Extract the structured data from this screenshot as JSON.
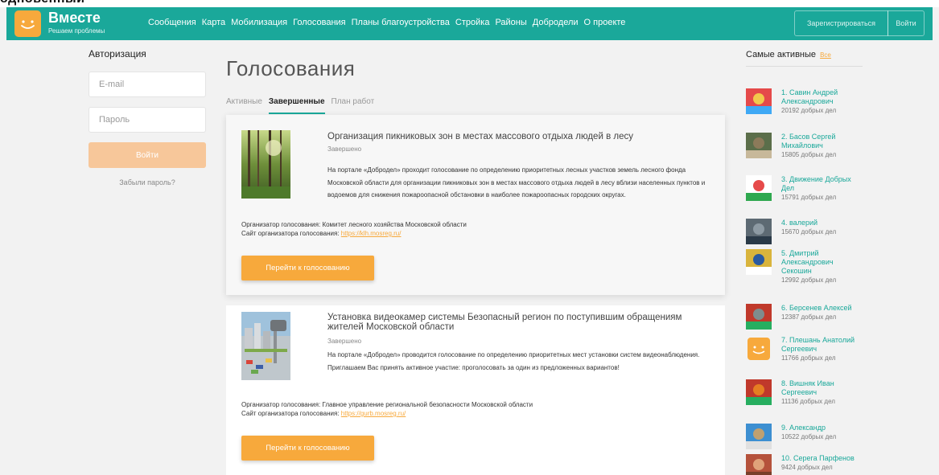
{
  "top_strip_text": "одновенный",
  "header": {
    "brand": "Вместе",
    "tagline": "Решаем проблемы",
    "nav": [
      "Сообщения",
      "Карта",
      "Мобилизация",
      "Голосования",
      "Планы благоустройства",
      "Стройка",
      "Районы",
      "Добродели",
      "О проекте"
    ],
    "register_label": "Зарегистрироваться",
    "login_label": "Войти"
  },
  "auth": {
    "title": "Авторизация",
    "email_placeholder": "E-mail",
    "password_placeholder": "Пароль",
    "login_button": "Войти",
    "forgot": "Забыли пароль?"
  },
  "main": {
    "title": "Голосования",
    "tabs": [
      "Активные",
      "Завершенные",
      "План работ"
    ],
    "active_tab": "Завершенные",
    "cards": [
      {
        "title": "Организация пикниковых зон в местах массового отдыха людей в лесу",
        "status": "Завершено",
        "description": "На портале «Добродел» проходит голосование по определению приоритетных лесных участков земель лесного фонда Московской области для организации пикниковых зон в местах массового отдыха людей в лесу вблизи населенных пунктов и водоемов для снижения пожароопасной обстановки в наиболее пожароопасных городских округах.",
        "organizer_label": "Организатор голосования:",
        "organizer": "Комитет лесного хозяйства Московской области",
        "site_label": "Сайт организатора голосования:",
        "site": "https://klh.mosreg.ru/",
        "button": "Перейти к голосованию",
        "image": "forest-photo"
      },
      {
        "title": "Установка видеокамер системы Безопасный регион по поступившим обращениям жителей Московской области",
        "status": "Завершено",
        "description": "На портале «Добродел» проводится голосование по определению приоритетных мест установки систем видеонаблюдения. Приглашаем Вас принять активное участие: проголосовать за один из предложенных вариантов!",
        "organizer_label": "Организатор голосования:",
        "organizer": "Главное управление региональной безопасности Московской области",
        "site_label": "Сайт организатора голосования:",
        "site": "https://gurb.mosreg.ru/",
        "button": "Перейти к голосованию",
        "image": "camera-street-photo"
      }
    ]
  },
  "sidebar": {
    "title": "Самые активные",
    "all_link": "Все",
    "users": [
      {
        "rank": "1.",
        "name": "Савин Андрей Александрович",
        "deeds": "20192 добрых дел"
      },
      {
        "rank": "2.",
        "name": "Басов Сергей Михайлович",
        "deeds": "15805 добрых дел"
      },
      {
        "rank": "3.",
        "name": "Движение Добрых Дел",
        "deeds": "15791 добрых дел"
      },
      {
        "rank": "4.",
        "name": "валерий",
        "deeds": "15670 добрых дел"
      },
      {
        "rank": "5.",
        "name": "Дмитрий Александрович Секошин",
        "deeds": "12992 добрых дел"
      },
      {
        "rank": "6.",
        "name": "Берсенев Алексей",
        "deeds": "12387 добрых дел"
      },
      {
        "rank": "7.",
        "name": "Плешань Анатолий Сергеевич",
        "deeds": "11766 добрых дел"
      },
      {
        "rank": "8.",
        "name": "Вишняк Иван Сергеевич",
        "deeds": "11136 добрых дел"
      },
      {
        "rank": "9.",
        "name": "Александр",
        "deeds": "10522 добрых дел"
      },
      {
        "rank": "10.",
        "name": "Серега Парфенов",
        "deeds": "9424 добрых дел"
      }
    ]
  },
  "colors": {
    "accent": "#1aa89a",
    "orange": "#f7a93c"
  }
}
